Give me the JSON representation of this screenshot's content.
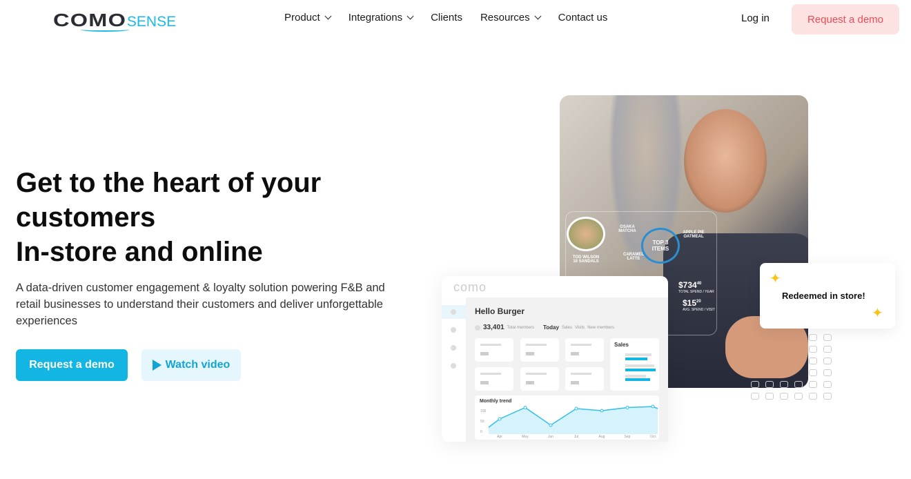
{
  "nav": {
    "logo": {
      "como": "COMO",
      "sense": "SENSE"
    },
    "items": [
      {
        "label": "Product",
        "dropdown": true
      },
      {
        "label": "Integrations",
        "dropdown": true
      },
      {
        "label": "Clients",
        "dropdown": false
      },
      {
        "label": "Resources",
        "dropdown": true
      },
      {
        "label": "Contact us",
        "dropdown": false
      }
    ],
    "login": "Log in",
    "demo": "Request a demo"
  },
  "hero": {
    "title_line1": "Get to the heart of your customers",
    "title_line2": "In-store and online",
    "subtitle": "A data-driven customer engagement & loyalty solution powering F&B and retail businesses to understand their customers and deliver unforgettable experiences",
    "cta_primary": "Request a demo",
    "cta_secondary": "Watch video",
    "accent": "#13b5e3"
  },
  "illustration": {
    "holo": {
      "customer": "TOD WILSON",
      "customer_sub": "10 SANDALS",
      "items_title": "TOP 3",
      "items_sub": "ITEMS",
      "item1": "OSAKA MATCHA",
      "item2": "CARAMEL LATTE",
      "item3": "APPLE PIE OATMEAL",
      "stat1": "$734",
      "stat1_cents": "40",
      "stat1_label": "TOTAL SPEND / YEAR",
      "stat2": "$15",
      "stat2_cents": "20",
      "stat2_label": "AVG. SPEND / VISIT"
    },
    "dashboard": {
      "logo": "como",
      "title": "Hello Burger",
      "members": "33,401",
      "members_label": "Total members",
      "today": "Today",
      "sales": "Sales",
      "visits": "Visits",
      "new_members": "New members",
      "sales_card": "Sales",
      "trend_title": "Monthly trend",
      "trend_y": [
        "100",
        "50",
        "0"
      ],
      "trend_x": [
        "Apr",
        "May",
        "Jun",
        "Jul",
        "Aug",
        "Sep",
        "Oct"
      ],
      "trend_values": [
        60,
        115,
        30,
        110,
        100,
        115,
        120
      ]
    },
    "redeemed": "Redeemed in store!"
  }
}
